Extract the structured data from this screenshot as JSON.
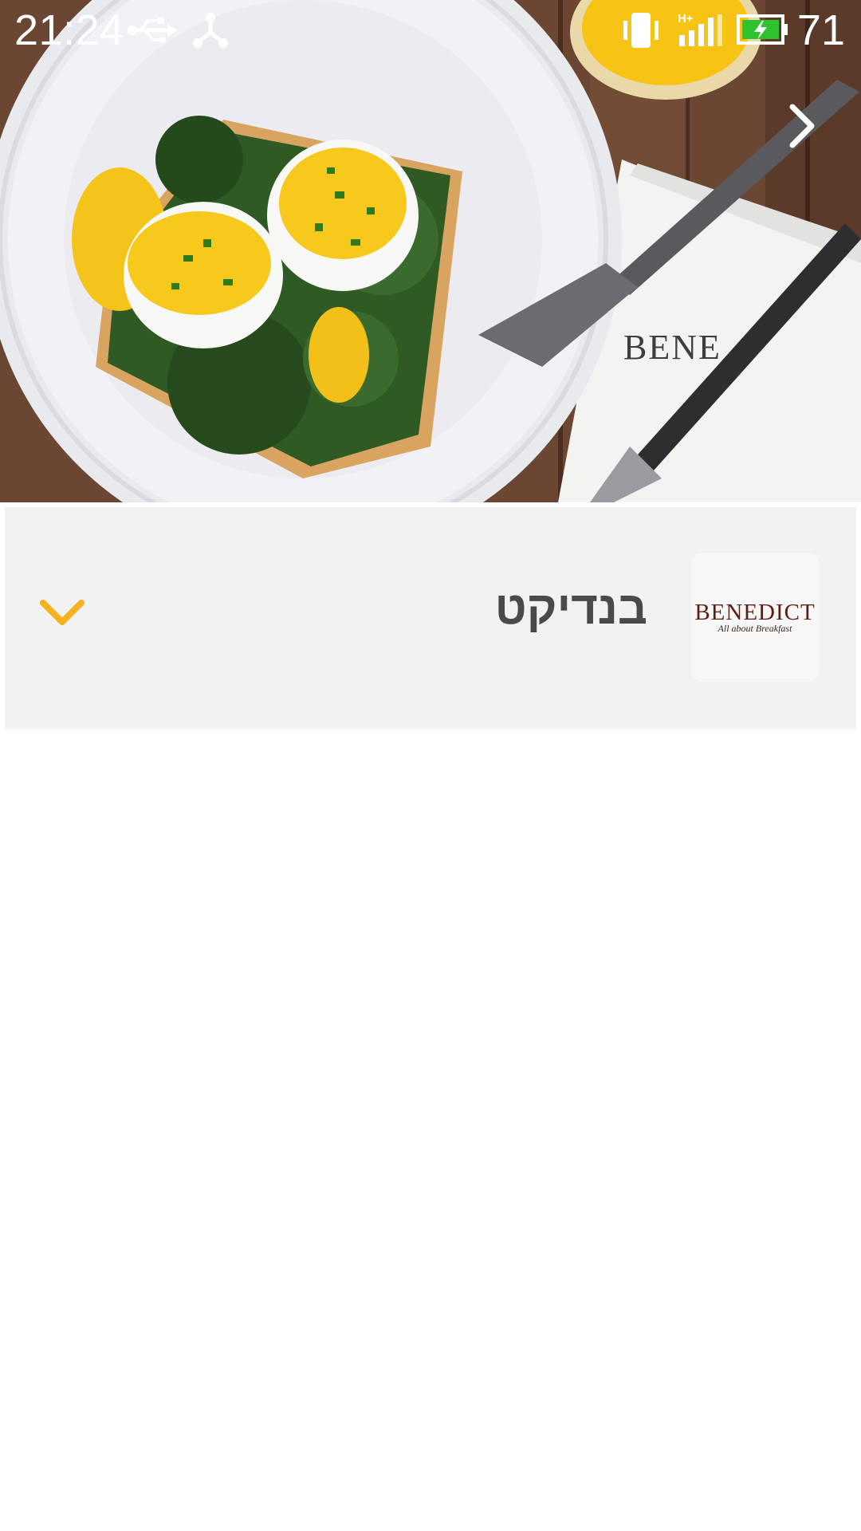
{
  "status_bar": {
    "time": "21:24",
    "battery_percent": "71",
    "icons": [
      "usb-icon",
      "hotspot-icon",
      "vibrate-icon",
      "signal-hplus-icon",
      "battery-charging-icon"
    ]
  },
  "hero": {
    "icons": [
      "chevron-right-icon"
    ]
  },
  "restaurant": {
    "name": "בנדיקט",
    "logo_text": "BENEDICT",
    "logo_tagline": "All about Breakfast",
    "expand_icon": "chevron-down-icon",
    "accent_color": "#f5b324"
  },
  "colors": {
    "card_background": "#f2f2f2",
    "name_text": "#4a4a4a",
    "accent": "#f5b324"
  }
}
